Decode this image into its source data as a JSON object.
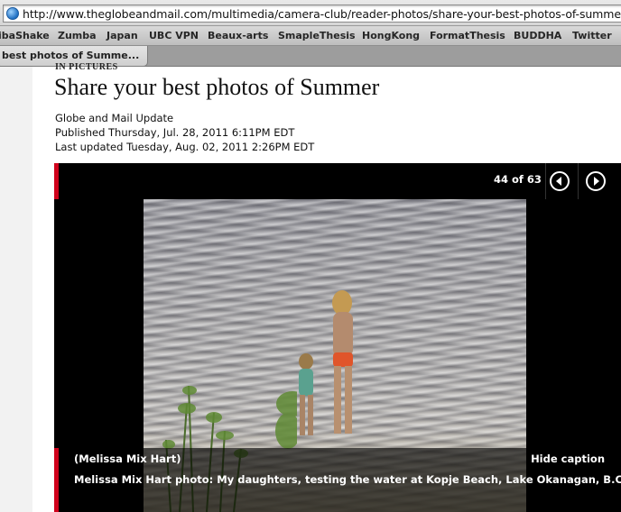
{
  "browser": {
    "url": "http://www.theglobeandmail.com/multimedia/camera-club/reader-photos/share-your-best-photos-of-summer/",
    "bookmarks": [
      "ibaShake",
      "Zumba",
      "Japan",
      "UBC VPN",
      "Beaux-arts",
      "SmapleThesis",
      "HongKong",
      "FormatThesis",
      "BUDDHA",
      "Twitter"
    ],
    "tab_title": "best photos of Summe..."
  },
  "article": {
    "kicker": "IN PICTURES",
    "title": "Share your best photos of Summer",
    "byline": "Globe and Mail Update",
    "published": "Published Thursday, Jul. 28, 2011 6:11PM EDT",
    "updated": "Last updated Tuesday, Aug. 02, 2011 2:26PM EDT"
  },
  "gallery": {
    "counter": "44 of 63",
    "credit": "(Melissa Mix Hart)",
    "hide_caption_label": "Hide caption",
    "caption": "Melissa Mix Hart photo: My daughters, testing the water at Kopje Beach, Lake Okanagan, B.C.",
    "accent_color": "#d0021b"
  },
  "icons": {
    "globe": "globe-icon",
    "prev": "previous-arrow-icon",
    "next": "next-arrow-icon"
  }
}
